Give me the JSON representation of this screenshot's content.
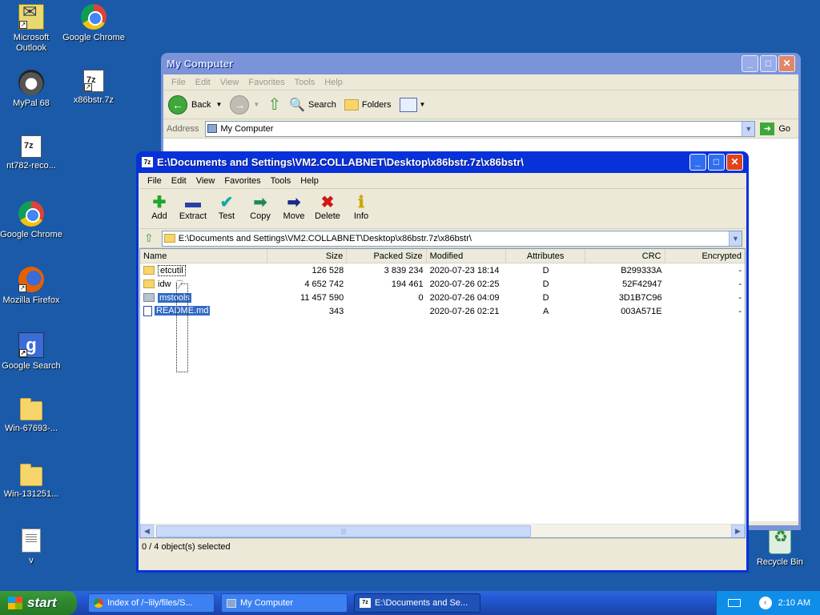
{
  "desktop": {
    "icons": [
      {
        "label": "Microsoft Outlook",
        "icon": "outlook-icon"
      },
      {
        "label": "Google Chrome",
        "icon": "chrome-icon"
      },
      {
        "label": "MyPal 68",
        "icon": "mypal-icon"
      },
      {
        "label": "x86bstr.7z",
        "icon": "archive-7z-icon"
      },
      {
        "label": "nt782-reco...",
        "icon": "document-icon"
      },
      {
        "label": "Google Chrome",
        "icon": "chrome-icon"
      },
      {
        "label": "Mozilla Firefox",
        "icon": "firefox-icon"
      },
      {
        "label": "Google Search",
        "icon": "google-search-icon"
      },
      {
        "label": "Win-67693-...",
        "icon": "folder-icon"
      },
      {
        "label": "Win-131251...",
        "icon": "folder-icon"
      },
      {
        "label": "v",
        "icon": "document-icon"
      },
      {
        "label": "Recycle Bin",
        "icon": "recycle-bin-icon"
      }
    ]
  },
  "my_computer": {
    "title": "My Computer",
    "menu": [
      "File",
      "Edit",
      "View",
      "Favorites",
      "Tools",
      "Help"
    ],
    "toolbar": {
      "back": "Back",
      "search": "Search",
      "folders": "Folders"
    },
    "address_label": "Address",
    "address_value": "My Computer",
    "go_label": "Go"
  },
  "sevenzip": {
    "title": "E:\\Documents and Settings\\VM2.COLLABNET\\Desktop\\x86bstr.7z\\x86bstr\\",
    "menu": [
      "File",
      "Edit",
      "View",
      "Favorites",
      "Tools",
      "Help"
    ],
    "toolbar": [
      {
        "label": "Add",
        "glyph": "✚",
        "color": "#22a52a"
      },
      {
        "label": "Extract",
        "glyph": "▬",
        "color": "#2a3fa8"
      },
      {
        "label": "Test",
        "glyph": "✔",
        "color": "#1aa6a6"
      },
      {
        "label": "Copy",
        "glyph": "➡",
        "color": "#1a8a5a"
      },
      {
        "label": "Move",
        "glyph": "➡",
        "color": "#1a2a8a"
      },
      {
        "label": "Delete",
        "glyph": "✖",
        "color": "#d01818"
      },
      {
        "label": "Info",
        "glyph": "ℹ",
        "color": "#c8a800"
      }
    ],
    "path": "E:\\Documents and Settings\\VM2.COLLABNET\\Desktop\\x86bstr.7z\\x86bstr\\",
    "columns": [
      "Name",
      "Size",
      "Packed Size",
      "Modified",
      "Attributes",
      "CRC",
      "Encrypted"
    ],
    "rows": [
      {
        "name": "etcutil",
        "type": "folder",
        "size": "126 528",
        "packed": "3 839 234",
        "modified": "2020-07-23 18:14",
        "attr": "D",
        "crc": "B299333A",
        "enc": "-"
      },
      {
        "name": "idw",
        "type": "folder",
        "size": "4 652 742",
        "packed": "194 461",
        "modified": "2020-07-26 02:25",
        "attr": "D",
        "crc": "52F42947",
        "enc": "-"
      },
      {
        "name": "mstools",
        "type": "folder-selected",
        "size": "11 457 590",
        "packed": "0",
        "modified": "2020-07-26 04:09",
        "attr": "D",
        "crc": "3D1B7C96",
        "enc": "-"
      },
      {
        "name": "README.md",
        "type": "file",
        "size": "343",
        "packed": "",
        "modified": "2020-07-26 02:21",
        "attr": "A",
        "crc": "003A571E",
        "enc": "-"
      }
    ],
    "status": "0 / 4 object(s) selected"
  },
  "taskbar": {
    "start": "start",
    "tasks": [
      {
        "label": "Index of /~lily/files/S...",
        "icon": "chrome-icon"
      },
      {
        "label": "My Computer",
        "icon": "computer-icon"
      },
      {
        "label": "E:\\Documents and Se...",
        "icon": "archive-7z-icon"
      }
    ],
    "clock": "2:10 AM"
  }
}
